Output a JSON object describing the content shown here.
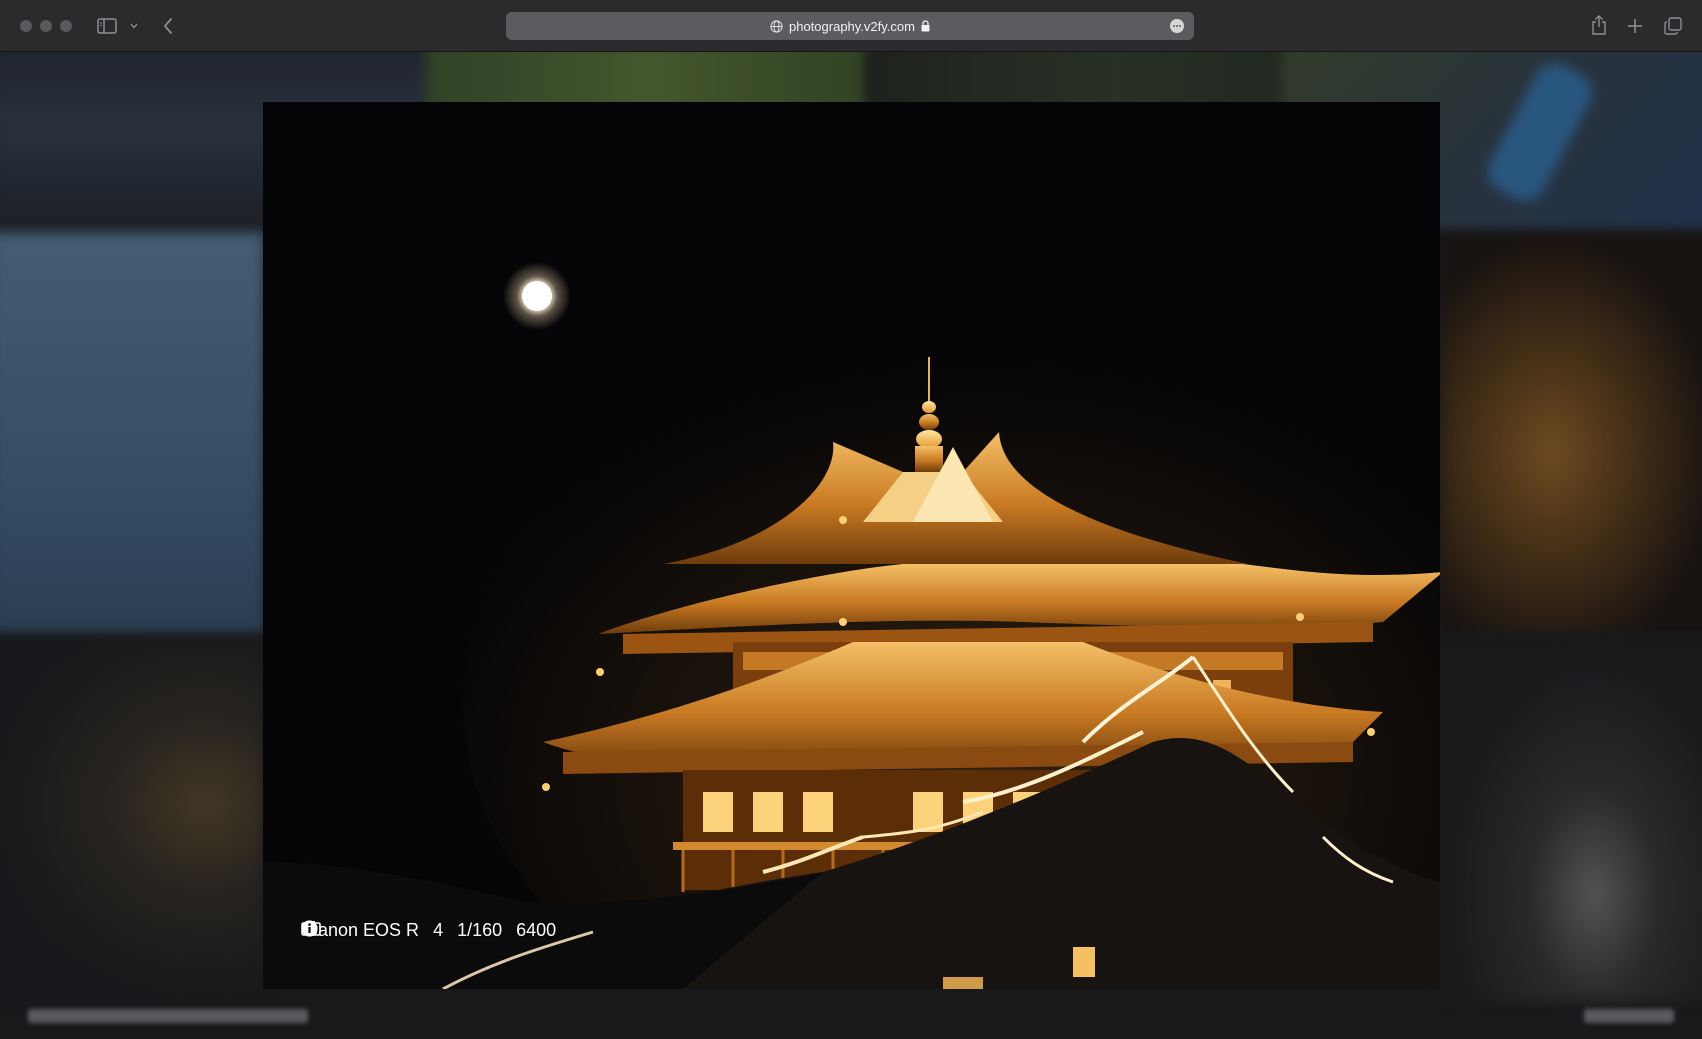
{
  "browser": {
    "url": "photography.v2fy.com"
  },
  "photo": {
    "exif": {
      "camera": "Canon EOS R",
      "aperture": "4",
      "shutter": "1/160",
      "iso": "6400"
    }
  },
  "colors": {
    "chrome_bg": "#2b2b2d",
    "urlbar_bg": "#5c5c60",
    "temple_gold": "#e7a33c",
    "night_sky": "#050507"
  },
  "icons": [
    "sidebar-icon",
    "chevron-down-icon",
    "back-icon",
    "globe-icon",
    "lock-icon",
    "more-icon",
    "share-icon",
    "plus-icon",
    "tabs-icon",
    "camera-icon",
    "aperture-icon",
    "clock-icon",
    "info-icon"
  ]
}
